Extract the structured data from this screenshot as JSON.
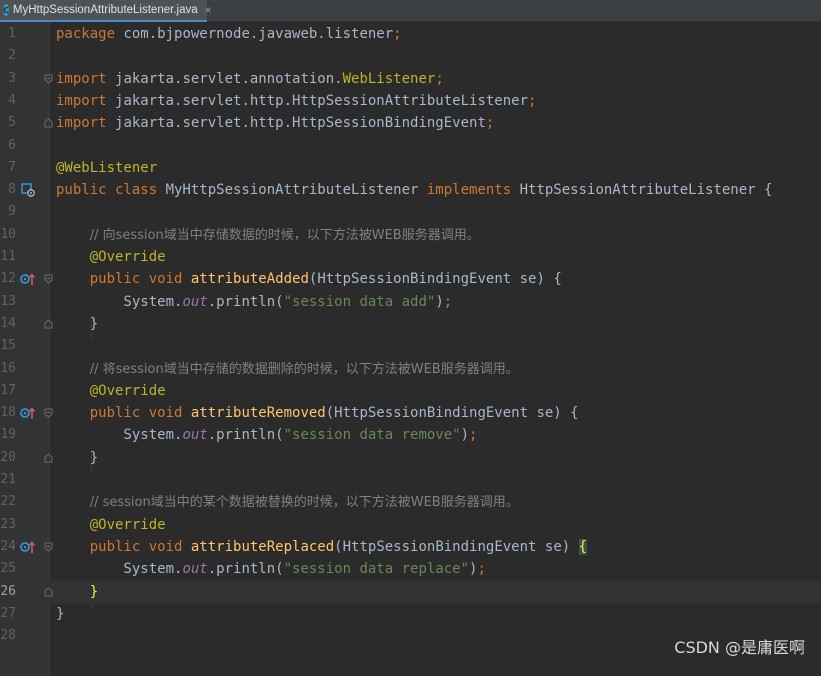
{
  "tab": {
    "filename": "MyHttpSessionAttributeListener.java",
    "icon": "java-class-icon",
    "close": "×"
  },
  "editor": {
    "current_line": 26,
    "lines": [
      {
        "n": "1",
        "tokens": [
          [
            "kw",
            "package "
          ],
          [
            "",
            "com.bjpowernode.javaweb.listener"
          ],
          [
            "kw",
            ";"
          ]
        ]
      },
      {
        "n": "2",
        "tokens": []
      },
      {
        "n": "3",
        "fold": "open",
        "tokens": [
          [
            "kw",
            "import "
          ],
          [
            "",
            "jakarta.servlet.annotation."
          ],
          [
            "ann",
            "WebListener"
          ],
          [
            "kw",
            ";"
          ]
        ]
      },
      {
        "n": "4",
        "tokens": [
          [
            "kw",
            "import "
          ],
          [
            "",
            "jakarta.servlet.http.HttpSessionAttributeListener"
          ],
          [
            "kw",
            ";"
          ]
        ]
      },
      {
        "n": "5",
        "fold": "close",
        "tokens": [
          [
            "kw",
            "import "
          ],
          [
            "",
            "jakarta.servlet.http.HttpSessionBindingEvent"
          ],
          [
            "kw",
            ";"
          ]
        ]
      },
      {
        "n": "6",
        "tokens": []
      },
      {
        "n": "7",
        "tokens": [
          [
            "ann",
            "@WebListener"
          ]
        ]
      },
      {
        "n": "8",
        "mark": "implementation-marker",
        "tokens": [
          [
            "kw",
            "public class "
          ],
          [
            "",
            "MyHttpSessionAttributeListener "
          ],
          [
            "kw",
            "implements "
          ],
          [
            "",
            "HttpSessionAttributeListener {"
          ]
        ]
      },
      {
        "n": "9",
        "tokens": []
      },
      {
        "n": "10",
        "tokens": [
          [
            "",
            "    "
          ],
          [
            "cmt",
            "// 向session域当中存储数据的时候，以下方法被WEB服务器调用。"
          ]
        ]
      },
      {
        "n": "11",
        "tokens": [
          [
            "",
            "    "
          ],
          [
            "ann",
            "@Override"
          ]
        ]
      },
      {
        "n": "12",
        "mark": "override-marker",
        "fold": "open",
        "tokens": [
          [
            "",
            "    "
          ],
          [
            "kw",
            "public void "
          ],
          [
            "fn",
            "attributeAdded"
          ],
          [
            "",
            "(HttpSessionBindingEvent se) {"
          ]
        ]
      },
      {
        "n": "13",
        "tokens": [
          [
            "",
            "        System."
          ],
          [
            "fld",
            "out"
          ],
          [
            "",
            ".println("
          ],
          [
            "str",
            "\"session data add\""
          ],
          [
            "",
            ")"
          ],
          [
            "kw",
            ";"
          ]
        ]
      },
      {
        "n": "14",
        "fold": "close",
        "tokens": [
          [
            "",
            "    }"
          ]
        ]
      },
      {
        "n": "15",
        "tokens": []
      },
      {
        "n": "16",
        "tokens": [
          [
            "",
            "    "
          ],
          [
            "cmt",
            "// 将session域当中存储的数据删除的时候，以下方法被WEB服务器调用。"
          ]
        ]
      },
      {
        "n": "17",
        "tokens": [
          [
            "",
            "    "
          ],
          [
            "ann",
            "@Override"
          ]
        ]
      },
      {
        "n": "18",
        "mark": "override-marker",
        "fold": "open",
        "tokens": [
          [
            "",
            "    "
          ],
          [
            "kw",
            "public void "
          ],
          [
            "fn",
            "attributeRemoved"
          ],
          [
            "",
            "(HttpSessionBindingEvent se) {"
          ]
        ]
      },
      {
        "n": "19",
        "tokens": [
          [
            "",
            "        System."
          ],
          [
            "fld",
            "out"
          ],
          [
            "",
            ".println("
          ],
          [
            "str",
            "\"session data remove\""
          ],
          [
            "",
            ")"
          ],
          [
            "kw",
            ";"
          ]
        ]
      },
      {
        "n": "20",
        "fold": "close",
        "tokens": [
          [
            "",
            "    }"
          ]
        ]
      },
      {
        "n": "21",
        "tokens": []
      },
      {
        "n": "22",
        "tokens": [
          [
            "",
            "    "
          ],
          [
            "cmt",
            "// session域当中的某个数据被替换的时候，以下方法被WEB服务器调用。"
          ]
        ]
      },
      {
        "n": "23",
        "tokens": [
          [
            "",
            "    "
          ],
          [
            "ann",
            "@Override"
          ]
        ]
      },
      {
        "n": "24",
        "mark": "override-marker",
        "fold": "open",
        "tokens": [
          [
            "",
            "    "
          ],
          [
            "kw",
            "public void "
          ],
          [
            "fn",
            "attributeReplaced"
          ],
          [
            "",
            "(HttpSessionBindingEvent se) "
          ],
          [
            "bm",
            "{"
          ]
        ]
      },
      {
        "n": "25",
        "tokens": [
          [
            "",
            "        System."
          ],
          [
            "fld",
            "out"
          ],
          [
            "",
            ".println("
          ],
          [
            "str",
            "\"session data replace\""
          ],
          [
            "",
            ")"
          ],
          [
            "kw",
            ";"
          ]
        ]
      },
      {
        "n": "26",
        "fold": "close",
        "tokens": [
          [
            "",
            "    "
          ],
          [
            "bm2",
            "}"
          ]
        ]
      },
      {
        "n": "27",
        "tokens": [
          [
            "",
            "}"
          ]
        ]
      },
      {
        "n": "28",
        "tokens": []
      }
    ]
  },
  "watermark": "CSDN @是庸医啊",
  "colors": {
    "background": "#2b2b2b",
    "gutter": "#313335",
    "keyword": "#cc7832",
    "annotation": "#bbb529",
    "method": "#ffc66d",
    "string": "#6a8759",
    "field": "#9876aa",
    "comment": "#808080",
    "text": "#a9b7c6",
    "current_line": "#323232"
  }
}
